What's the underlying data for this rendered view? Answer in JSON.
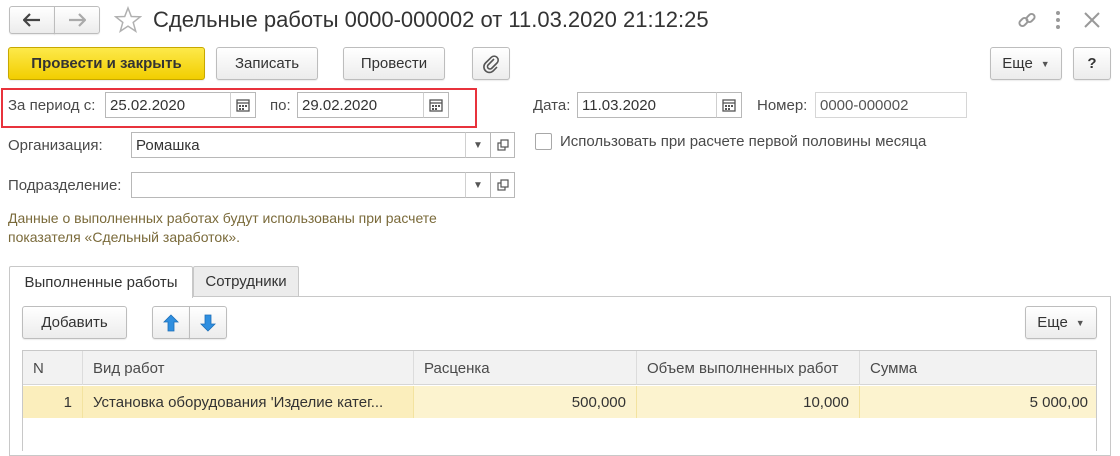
{
  "window": {
    "title": "Сдельные работы 0000-000002 от 11.03.2020 21:12:25"
  },
  "toolbar": {
    "post_close": "Провести и закрыть",
    "save": "Записать",
    "post": "Провести",
    "more": "Еще",
    "help": "?"
  },
  "form": {
    "period_from_label": "За период с:",
    "period_from_value": "25.02.2020",
    "period_to_label": "по:",
    "period_to_value": "29.02.2020",
    "date_label": "Дата:",
    "date_value": "11.03.2020",
    "number_label": "Номер:",
    "number_value": "0000-000002",
    "org_label": "Организация:",
    "org_value": "Ромашка",
    "dept_label": "Подразделение:",
    "dept_value": "",
    "first_half_label": "Использовать при расчете первой половины месяца",
    "first_half_checked": false,
    "info_line1": "Данные о выполненных работах будут использованы при расчете",
    "info_line2": "показателя «Сдельный заработок»."
  },
  "tabs": [
    {
      "label": "Выполненные работы",
      "active": true
    },
    {
      "label": "Сотрудники",
      "active": false
    }
  ],
  "table_toolbar": {
    "add": "Добавить",
    "more": "Еще"
  },
  "table": {
    "columns": [
      "N",
      "Вид работ",
      "Расценка",
      "Объем выполненных работ",
      "Сумма"
    ],
    "rows": [
      {
        "n": "1",
        "work_type": "Установка оборудования 'Изделие катег...",
        "rate": "500,000",
        "volume": "10,000",
        "sum": "5 000,00"
      }
    ]
  },
  "colors": {
    "accent_yellow": "#f5d600",
    "highlight_red": "#e8323c",
    "selected_row": "#fbeebc",
    "info_text": "#7a6a3a",
    "arrow_blue": "#2f8fe0"
  }
}
